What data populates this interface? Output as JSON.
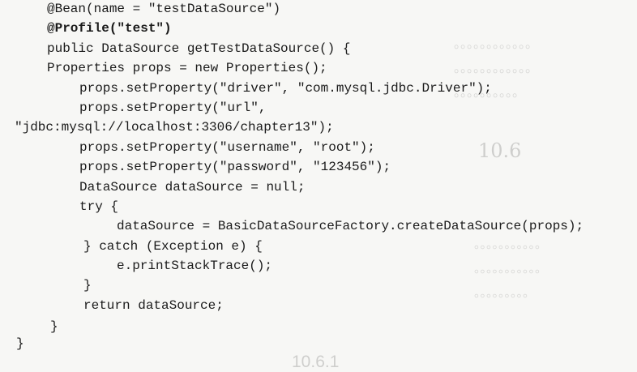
{
  "code": {
    "lines": [
      "@Bean(name = \"testDataSource\")",
      "@Profile(\"test\")",
      "public DataSource getTestDataSource() {",
      "Properties props = new Properties();",
      "props.setProperty(\"driver\", \"com.mysql.jdbc.Driver\");",
      "props.setProperty(\"url\",",
      "\"jdbc:mysql://localhost:3306/chapter13\");",
      "props.setProperty(\"username\", \"root\");",
      "props.setProperty(\"password\", \"123456\");",
      "DataSource dataSource = null;",
      "try {",
      "dataSource = BasicDataSourceFactory.createDataSource(props);",
      "} catch (Exception e) {",
      "e.printStackTrace();",
      "}",
      "return dataSource;",
      "}",
      "}"
    ]
  }
}
